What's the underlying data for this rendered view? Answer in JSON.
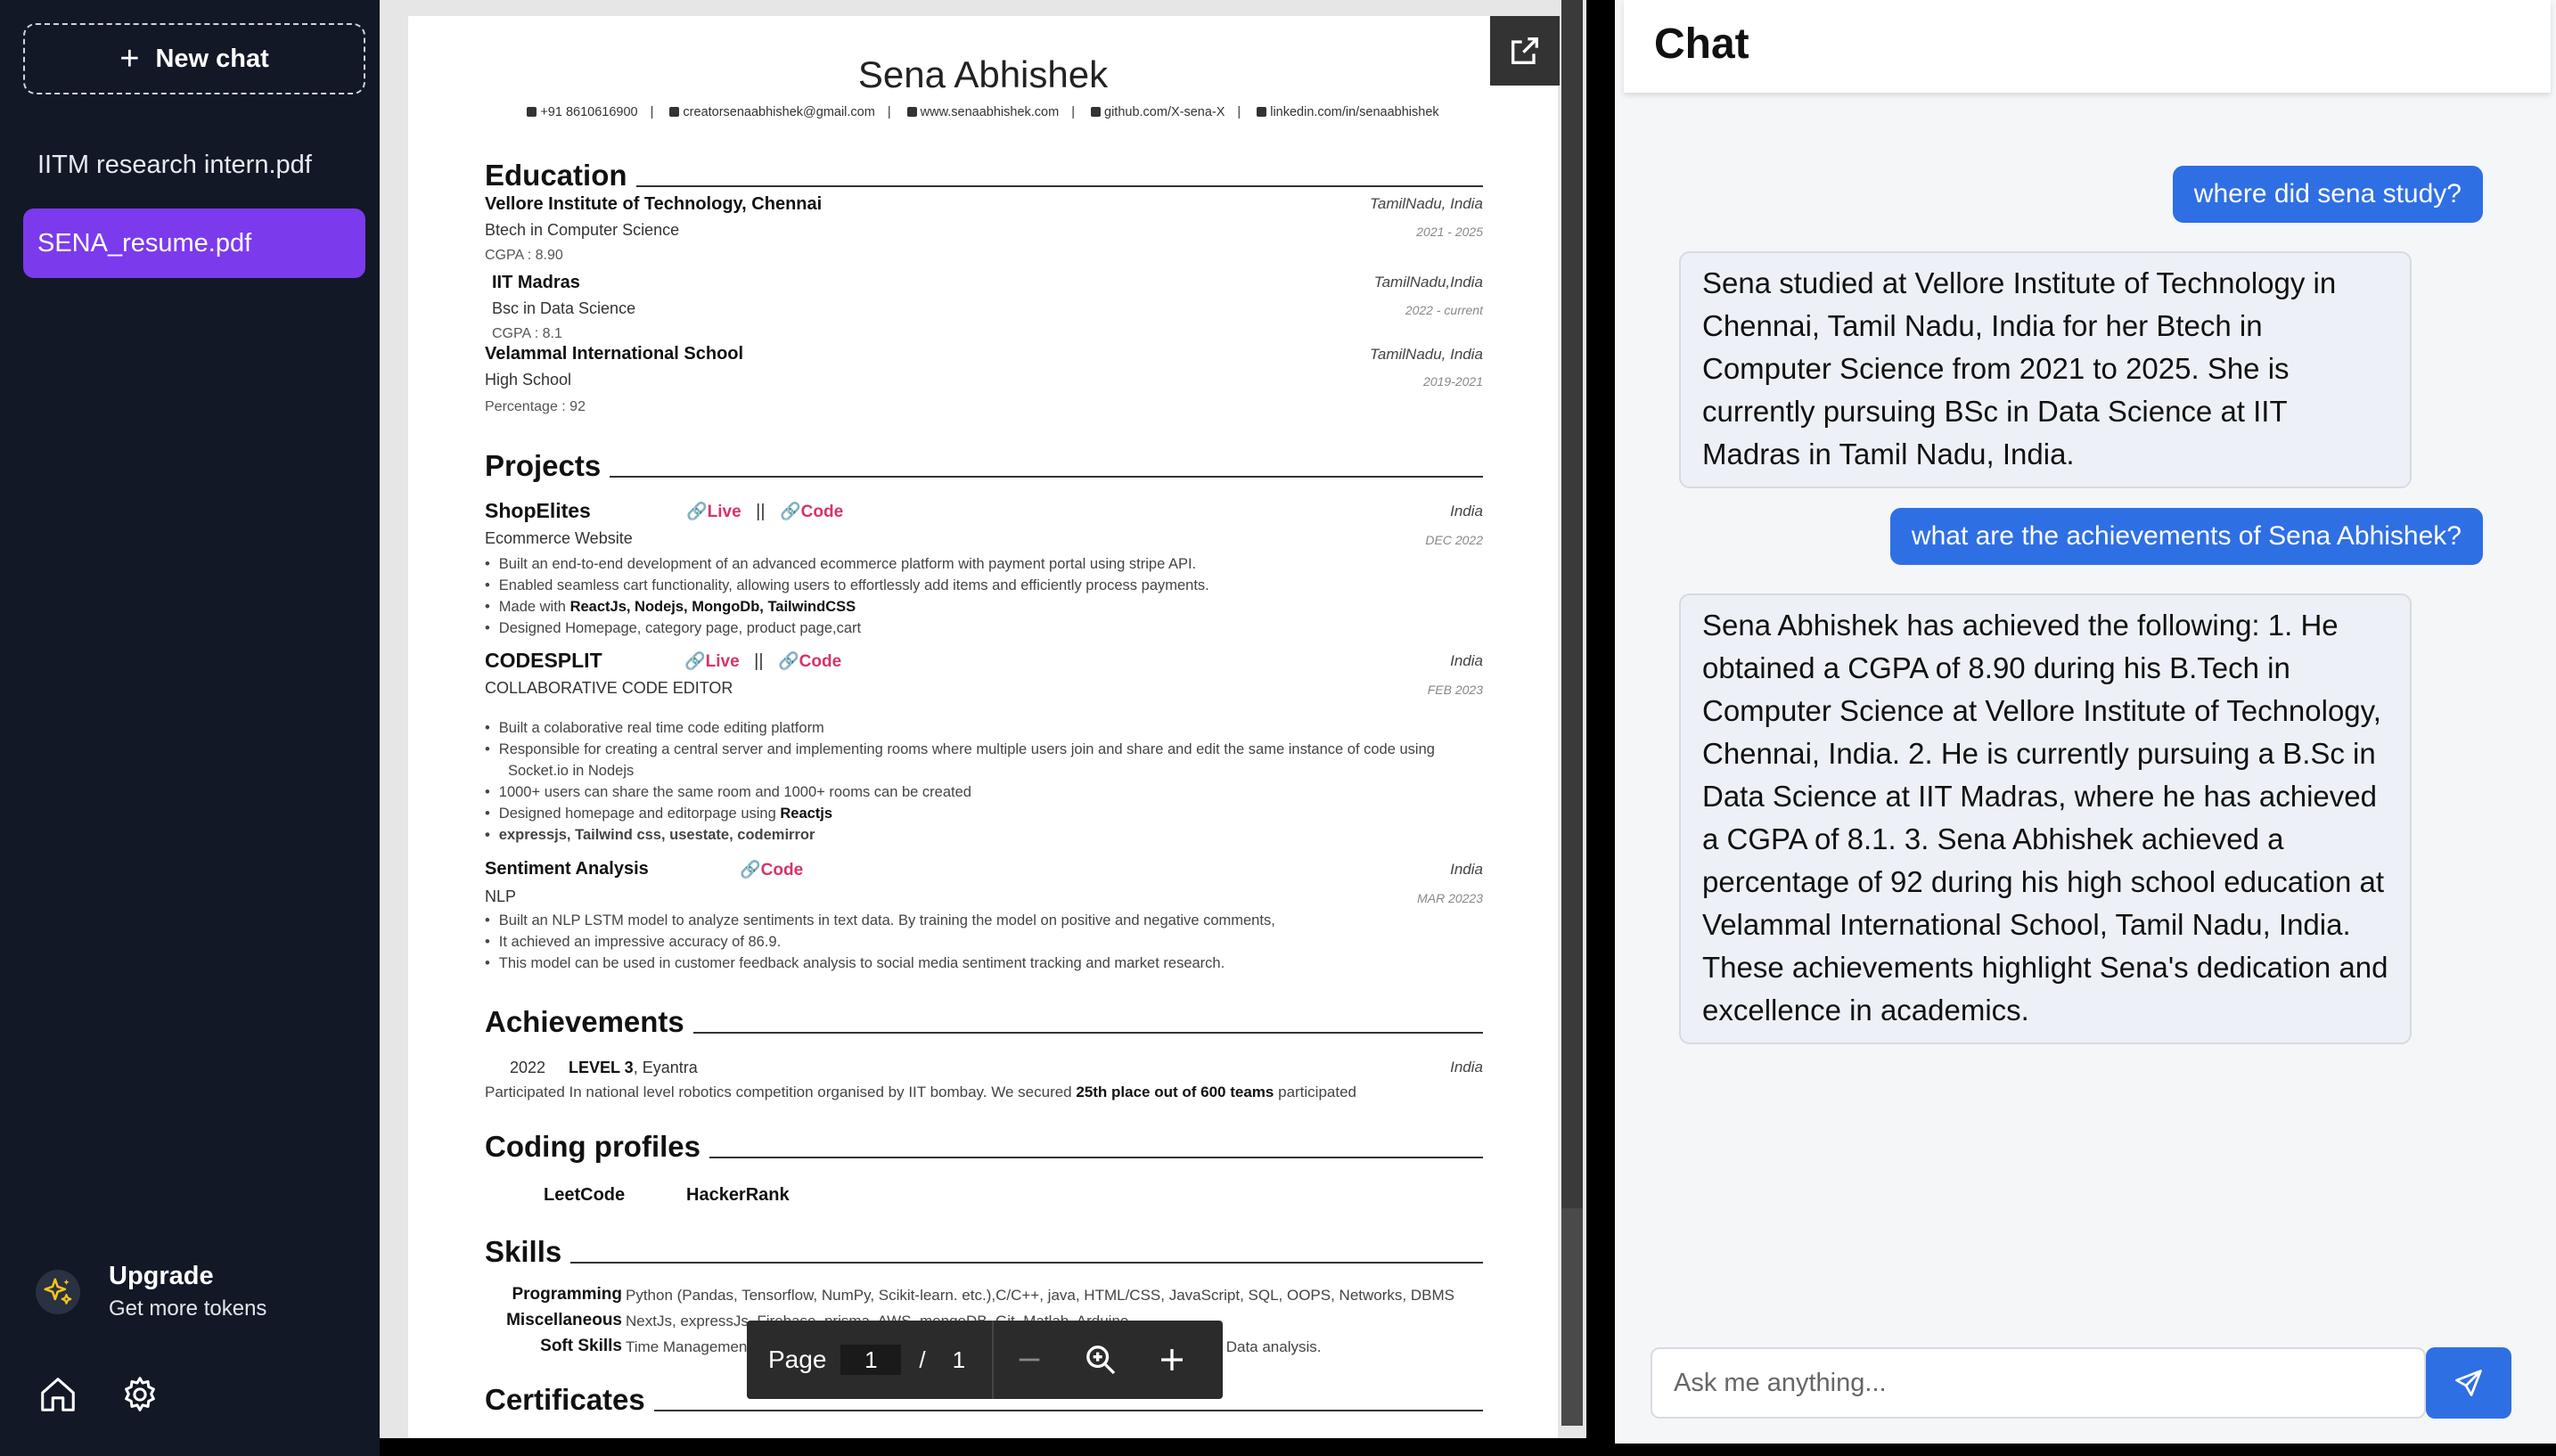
{
  "sidebar": {
    "new_chat_label": "New chat",
    "files": [
      {
        "label": "IITM research intern.pdf"
      },
      {
        "label": "SENA_resume.pdf"
      }
    ],
    "upgrade": {
      "title": "Upgrade",
      "subtitle": "Get more tokens"
    },
    "icons": {
      "home": "home-icon",
      "settings": "gear-icon",
      "upgrade": "sparkles-icon"
    }
  },
  "pdf": {
    "name": "Sena Abhishek",
    "contact": {
      "phone": "+91 8610616900",
      "email": "creatorsenaabhishek@gmail.com",
      "website": "www.senaabhishek.com",
      "github": "github.com/X-sena-X",
      "linkedin": "linkedin.com/in/senaabhishek"
    },
    "sections": {
      "education": "Education",
      "projects": "Projects",
      "achievements": "Achievements",
      "coding": "Coding profiles",
      "skills": "Skills",
      "certificates": "Certificates"
    },
    "education": [
      {
        "org": "Vellore Institute of Technology, Chennai",
        "degree": "Btech in Computer Science",
        "score": "CGPA : 8.90",
        "location": "TamilNadu, India",
        "date": "2021 - 2025"
      },
      {
        "org": "IIT Madras",
        "degree": "Bsc in Data Science",
        "score": "CGPA : 8.1",
        "location": "TamilNadu,India",
        "date": "2022 - current"
      },
      {
        "org": "Velammal International School",
        "degree": "High School",
        "score": "Percentage : 92",
        "location": "TamilNadu, India",
        "date": "2019-2021"
      }
    ],
    "projects": {
      "live": "Live",
      "code": "Code",
      "divider": "||",
      "p1": {
        "title": "ShopElites",
        "sub": "Ecommerce Website",
        "location": "India",
        "date": "DEC 2022",
        "b1": "Built an end-to-end development of an advanced ecommerce platform with payment portal using stripe API.",
        "b2": "Enabled seamless cart functionality, allowing users to effortlessly add items and efficiently process payments.",
        "b3_pre": "Made with ",
        "b3_bold": "ReactJs, Nodejs, MongoDb, TailwindCSS",
        "b4": "Designed Homepage, category page, product page,cart"
      },
      "p2": {
        "title": "CODESPLIT",
        "sub": "COLLABORATIVE CODE EDITOR",
        "location": "India",
        "date": "FEB 2023",
        "b1": "Built a colaborative real time code editing platform",
        "b2a": "Responsible for creating a central server and implementing rooms where multiple users join and share and edit the same instance of code using",
        "b2b": "Socket.io in Nodejs",
        "b3": "1000+ users can share the same room and 1000+ rooms can be created",
        "b4_pre": "Designed homepage and editorpage using ",
        "b4_bold": "Reactjs",
        "b5": "expressjs, Tailwind css, usestate, codemirror"
      },
      "p3": {
        "title": "Sentiment Analysis",
        "sub": "NLP",
        "location": "India",
        "date": "MAR 20223",
        "b1": "Built an NLP LSTM model to analyze sentiments in text data. By training the model on positive and negative comments,",
        "b2": "It achieved an impressive accuracy of 86.9.",
        "b3": "This model can be used in customer feedback analysis to social media sentiment tracking and market research."
      }
    },
    "achievement": {
      "year": "2022",
      "level": "LEVEL 3",
      "org": ", Eyantra",
      "location": "India",
      "desc_pre": "Participated In national level robotics competition organised by IIT bombay. We secured ",
      "desc_bold": "25th place out of 600 teams",
      "desc_post": " participated"
    },
    "coding": [
      "LeetCode",
      "HackerRank"
    ],
    "skills": [
      {
        "label": "Programming",
        "value": "Python (Pandas, Tensorflow, NumPy, Scikit-learn. etc.),C/C++, java, HTML/CSS, JavaScript, SQL, OOPS, Networks, DBMS"
      },
      {
        "label": "Miscellaneous",
        "value": "NextJs, expressJs, Firebase, prisma, AWS, mongoDB, Git, Matlab, Arduino"
      },
      {
        "label": "Soft Skills",
        "value": "Time Management, Teamwork, Problem-solving, Documentation, Engaging Presentation, Data analysis."
      }
    ],
    "toolbar": {
      "page_label": "Page",
      "current_page": "1",
      "separator": "/",
      "total_pages": "1"
    }
  },
  "chat": {
    "title": "Chat",
    "messages": [
      {
        "role": "user",
        "text": "where did sena study?"
      },
      {
        "role": "bot",
        "text": "Sena studied at Vellore Institute of Technology in Chennai, Tamil Nadu, India for her Btech in Computer Science from 2021 to 2025. She is currently pursuing BSc in Data Science at IIT Madras in Tamil Nadu, India."
      },
      {
        "role": "user",
        "text": "what are the achievements of Sena Abhishek?"
      },
      {
        "role": "bot",
        "text": "Sena Abhishek has achieved the following: 1. He obtained a CGPA of 8.90 during his B.Tech in Computer Science at Vellore Institute of Technology, Chennai, India. 2. He is currently pursuing a B.Sc in Data Science at IIT Madras, where he has achieved a CGPA of 8.1. 3. Sena Abhishek achieved a percentage of 92 during his high school education at Velammal International School, Tamil Nadu, India. These achievements highlight Sena's dedication and excellence in academics."
      }
    ],
    "input_placeholder": "Ask me anything..."
  },
  "colors": {
    "sidebar_bg": "#121826",
    "active_file": "#7c3aed",
    "accent_blue": "#2f6fe4",
    "link_pink": "#d6336c"
  }
}
